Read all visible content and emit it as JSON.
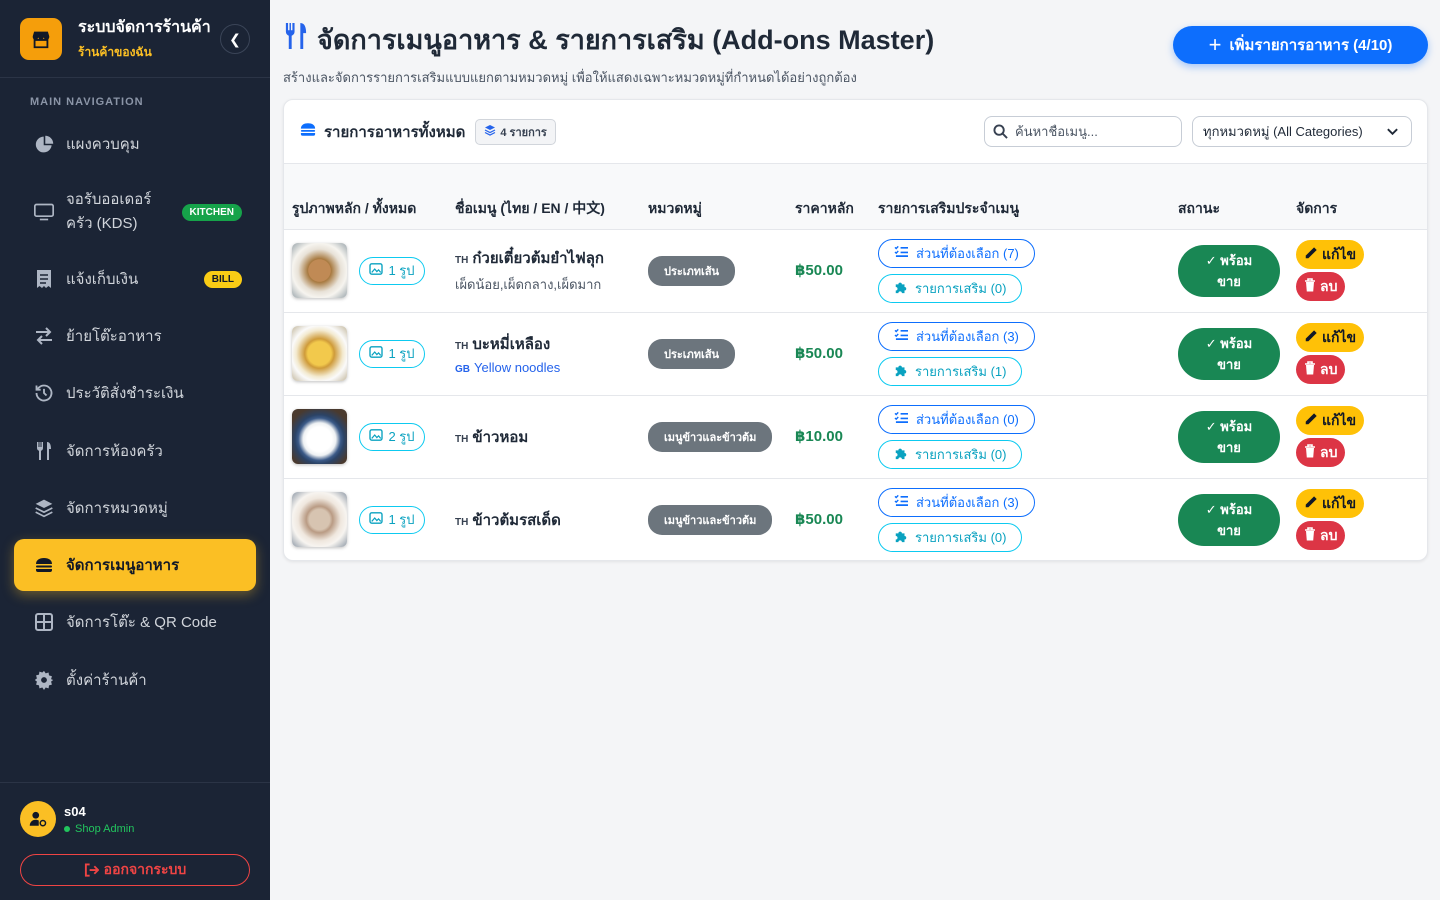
{
  "brand": {
    "title": "ระบบจัดการร้านค้า",
    "subtitle": "ร้านค้าของฉัน"
  },
  "nav": {
    "header": "MAIN NAVIGATION",
    "items": [
      {
        "label": "แผงควบคุม",
        "icon": "chart-pie-icon"
      },
      {
        "label": "จอรับออเดอร์ครัว (KDS)",
        "icon": "monitor-icon",
        "badge": "KITCHEN"
      },
      {
        "label": "แจ้งเก็บเงิน",
        "icon": "receipt-icon",
        "badge": "BILL"
      },
      {
        "label": "ย้ายโต๊ะอาหาร",
        "icon": "swap-icon"
      },
      {
        "label": "ประวัติสั่งชำระเงิน",
        "icon": "history-icon"
      },
      {
        "label": "จัดการห้องครัว",
        "icon": "utensils-icon"
      },
      {
        "label": "จัดการหมวดหมู่",
        "icon": "layers-icon"
      },
      {
        "label": "จัดการเมนูอาหาร",
        "icon": "burger-icon",
        "active": true
      },
      {
        "label": "จัดการโต๊ะ & QR Code",
        "icon": "grid-icon"
      },
      {
        "label": "ตั้งค่าร้านค้า",
        "icon": "gear-icon"
      }
    ]
  },
  "user": {
    "name": "s04",
    "role": "Shop Admin",
    "logout": "ออกจากระบบ"
  },
  "page": {
    "title": "จัดการเมนูอาหาร & รายการเสริม (Add-ons Master)",
    "subtitle": "สร้างและจัดการรายการเสริมแบบแยกตามหมวดหมู่ เพื่อให้แสดงเฉพาะหมวดหมู่ที่กำหนดได้อย่างถูกต้อง",
    "add_button": "เพิ่มรายการอาหาร (4/10)"
  },
  "card": {
    "title": "รายการอาหารทั้งหมด",
    "count": "4 รายการ",
    "search_placeholder": "ค้นหาชื่อเมนู...",
    "category_filter": "ทุกหมวดหมู่ (All Categories)"
  },
  "table": {
    "headers": {
      "image": "รูปภาพหลัก / ทั้งหมด",
      "name": "ชื่อเมนู (ไทย / EN / 中文)",
      "category": "หมวดหมู่",
      "price": "ราคาหลัก",
      "addons": "รายการเสริมประจำเมนู",
      "status": "สถานะ",
      "actions": "จัดการ"
    },
    "rows": [
      {
        "images": "1 รูป",
        "lang": "TH",
        "name": "ก๋วยเตี๋ยวต้มยำไฟลุก",
        "sub": "เผ็ดน้อย,เผ็ดกลาง,เผ็ดมาก",
        "en_lang": "",
        "en": "",
        "category": "ประเภทเส้น",
        "price": "฿50.00",
        "required": "ส่วนที่ต้องเลือก (7)",
        "extras": "รายการเสริม (0)",
        "status_1": "พร้อม",
        "status_2": "ขาย",
        "edit": "แก้ไข",
        "delete": "ลบ"
      },
      {
        "images": "1 รูป",
        "lang": "TH",
        "name": "บะหมี่เหลือง",
        "sub": "",
        "en_lang": "GB",
        "en": "Yellow noodles",
        "category": "ประเภทเส้น",
        "price": "฿50.00",
        "required": "ส่วนที่ต้องเลือก (3)",
        "extras": "รายการเสริม (1)",
        "status_1": "พร้อม",
        "status_2": "ขาย",
        "edit": "แก้ไข",
        "delete": "ลบ"
      },
      {
        "images": "2 รูป",
        "lang": "TH",
        "name": "ข้าวหอม",
        "sub": "",
        "en_lang": "",
        "en": "",
        "category": "เมนูข้าวและข้าวต้ม",
        "price": "฿10.00",
        "required": "ส่วนที่ต้องเลือก (0)",
        "extras": "รายการเสริม (0)",
        "status_1": "พร้อม",
        "status_2": "ขาย",
        "edit": "แก้ไข",
        "delete": "ลบ"
      },
      {
        "images": "1 รูป",
        "lang": "TH",
        "name": "ข้าวต้มรสเด็ด",
        "sub": "",
        "en_lang": "",
        "en": "",
        "category": "เมนูข้าวและข้าวต้ม",
        "price": "฿50.00",
        "required": "ส่วนที่ต้องเลือก (3)",
        "extras": "รายการเสริม (0)",
        "status_1": "พร้อม",
        "status_2": "ขาย",
        "edit": "แก้ไข",
        "delete": "ลบ"
      }
    ]
  },
  "colors": {
    "accent": "#0d6efd",
    "active_nav": "#fbbf24",
    "sidebar": "#1b2435",
    "success": "#198754",
    "danger": "#dc3545",
    "warning": "#ffc107"
  }
}
